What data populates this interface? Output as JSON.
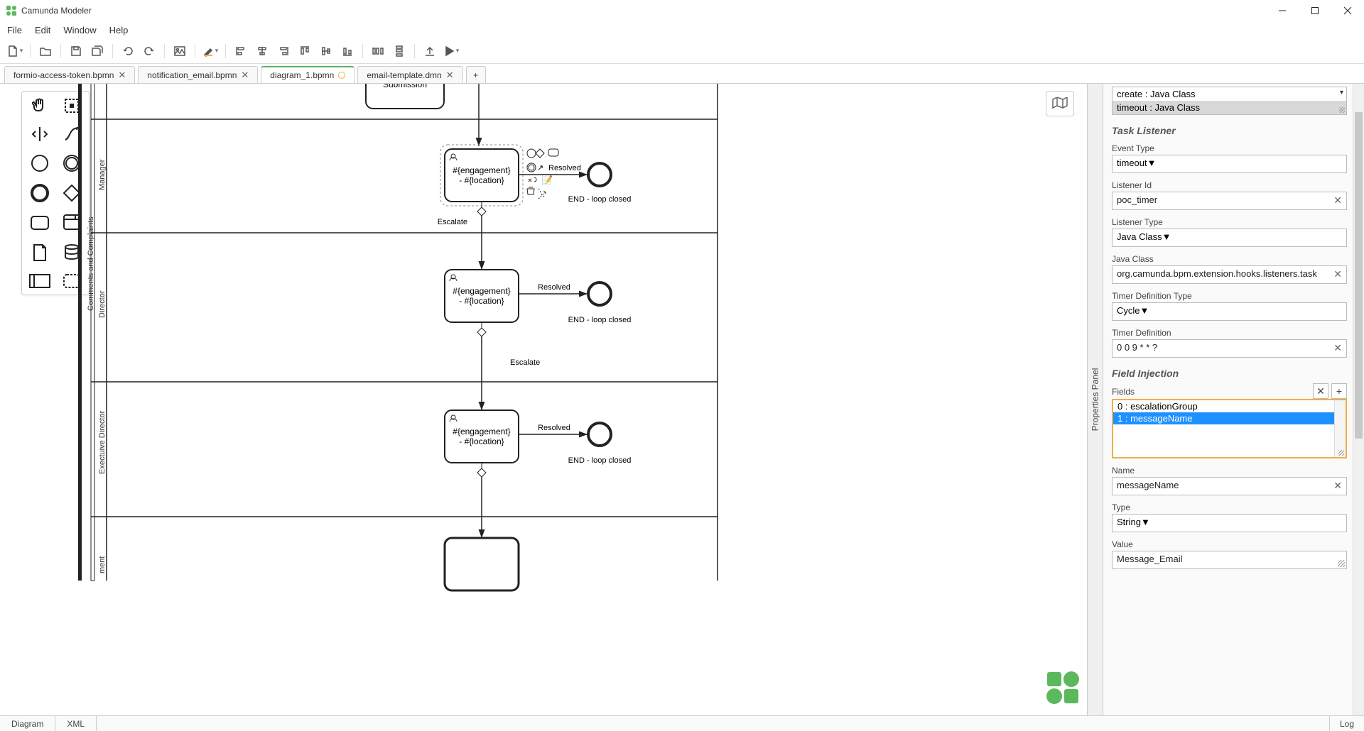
{
  "app_title": "Camunda Modeler",
  "menu": {
    "file": "File",
    "edit": "Edit",
    "window": "Window",
    "help": "Help"
  },
  "tabs": [
    {
      "label": "formio-access-token.bpmn"
    },
    {
      "label": "notification_email.bpmn"
    },
    {
      "label": "diagram_1.bpmn",
      "active": true,
      "unsaved": true
    },
    {
      "label": "email-template.dmn"
    }
  ],
  "lanes": {
    "pool": "Comments and Complaints",
    "l1": "Manager",
    "l2": "Director",
    "l3": "Exectuive Director",
    "l4": "ment"
  },
  "canvas": {
    "submission": "Submission",
    "task_text_1": "#{engagement}",
    "task_text_2": "- #{location}",
    "resolved": "Resolved",
    "end_loop": "END - loop closed",
    "escalate": "Escalate"
  },
  "minimap_title": "Minimap",
  "prop_panel_label": "Properties Panel",
  "prop": {
    "listeners_list": {
      "a": "create : Java Class",
      "b": "timeout : Java Class"
    },
    "section_task_listener": "Task Listener",
    "event_type_label": "Event Type",
    "event_type_value": "timeout",
    "listener_id_label": "Listener Id",
    "listener_id_value": "poc_timer",
    "listener_type_label": "Listener Type",
    "listener_type_value": "Java Class",
    "java_class_label": "Java Class",
    "java_class_value": "org.camunda.bpm.extension.hooks.listeners.task",
    "timer_def_type_label": "Timer Definition Type",
    "timer_def_type_value": "Cycle",
    "timer_def_label": "Timer Definition",
    "timer_def_value": "0 0 9 * * ?",
    "section_field_injection": "Field Injection",
    "fields_label": "Fields",
    "fields": {
      "a": "0 : escalationGroup",
      "b": "1 : messageName"
    },
    "name_label": "Name",
    "name_value": "messageName",
    "type_label": "Type",
    "type_value": "String",
    "value_label": "Value",
    "value_value": "Message_Email"
  },
  "footer": {
    "diagram": "Diagram",
    "xml": "XML",
    "log": "Log"
  }
}
